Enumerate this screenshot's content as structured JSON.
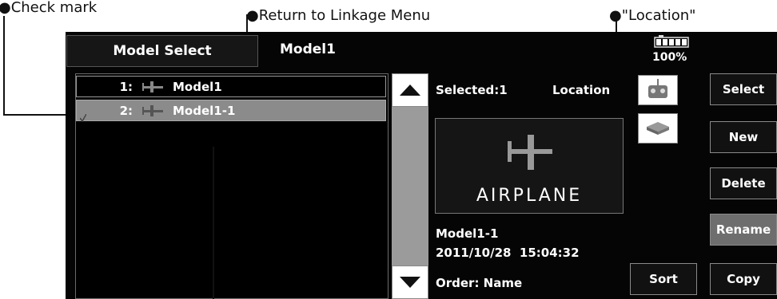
{
  "annotations": {
    "check_mark": "●Check mark",
    "return_linkage": "●Return to Linkage Menu",
    "location": "●\"Location\""
  },
  "header": {
    "menu_button": "Model Select",
    "model_name": "Model1",
    "battery_text": "100%",
    "battery_level": 1.0
  },
  "model_list": [
    {
      "index": "1:",
      "name": "Model1",
      "selected": false
    },
    {
      "index": "2:",
      "name": "Model1-1",
      "selected": true
    }
  ],
  "info": {
    "selected": "Selected:1",
    "location_label": "Location",
    "airplane_label": "AIRPLANE",
    "model_name": "Model1-1",
    "timestamp": "2011/10/28  15:04:32",
    "order": "Order: Name"
  },
  "buttons": {
    "select": "Select",
    "new": "New",
    "delete": "Delete",
    "rename": "Rename",
    "copy": "Copy",
    "sort": "Sort"
  },
  "colors": {
    "screen_bg": "#050505",
    "selected_row": "#8b8b8b",
    "active_button": "#6e6e6e"
  }
}
